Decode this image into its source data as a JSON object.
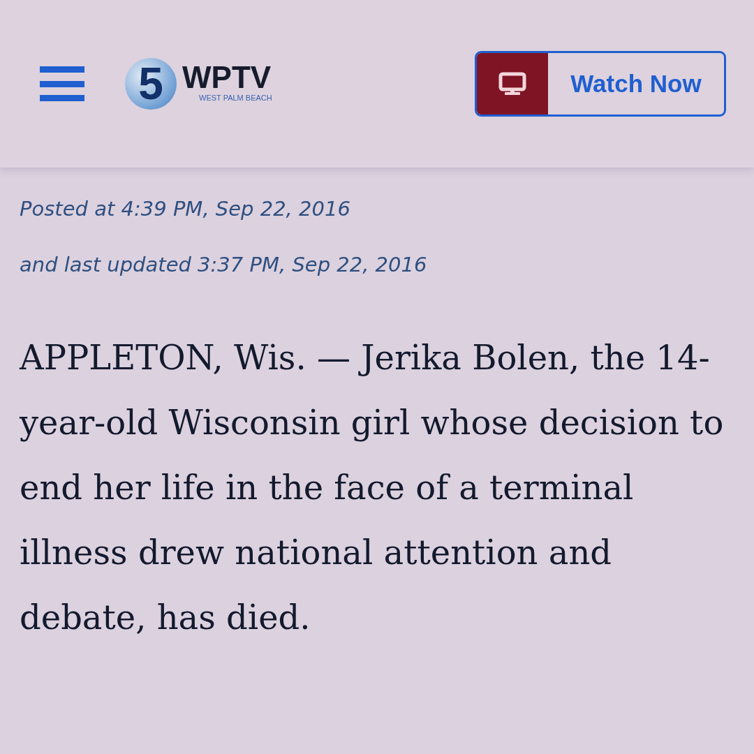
{
  "header": {
    "logo": {
      "mark": "5",
      "name": "WPTV",
      "tagline": "WEST PALM BEACH"
    },
    "watch_button": {
      "label": "Watch Now"
    }
  },
  "article": {
    "posted": "Posted at 4:39 PM, Sep 22, 2016",
    "updated": "and last updated 3:37 PM, Sep 22, 2016",
    "body": "APPLETON, Wis. — Jerika Bolen, the 14-year-old Wisconsin girl whose decision to end her life in the face of a terminal illness drew national attention and debate, has died."
  }
}
